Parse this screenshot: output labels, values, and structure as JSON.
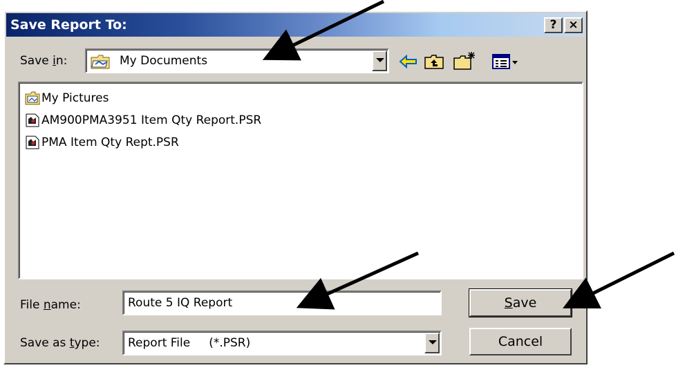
{
  "dialog": {
    "title": "Save Report To:",
    "help_glyph": "?",
    "close_glyph": "×"
  },
  "save_in": {
    "label_pre": "Save ",
    "label_underlined": "i",
    "label_post": "n:",
    "value": "My Documents"
  },
  "files": [
    {
      "name": "My Pictures",
      "icon": "folder-pictures-icon"
    },
    {
      "name": "AM900PMA3951 Item Qty Report.PSR",
      "icon": "report-file-icon"
    },
    {
      "name": "PMA Item Qty Rept.PSR",
      "icon": "report-file-icon"
    }
  ],
  "file_name": {
    "label_pre": "File ",
    "label_underlined": "n",
    "label_post": "ame:",
    "value": "Route 5 IQ Report"
  },
  "save_as_type": {
    "label_pre": "Save as ",
    "label_underlined": "t",
    "label_post": "ype:",
    "value": "Report File     (*.PSR)"
  },
  "buttons": {
    "save_underlined": "S",
    "save_rest": "ave",
    "cancel": "Cancel"
  },
  "colors": {
    "window": "#d4d0c8",
    "title_start": "#0a246a",
    "title_end": "#a6caf0",
    "arrow": "#000000"
  }
}
